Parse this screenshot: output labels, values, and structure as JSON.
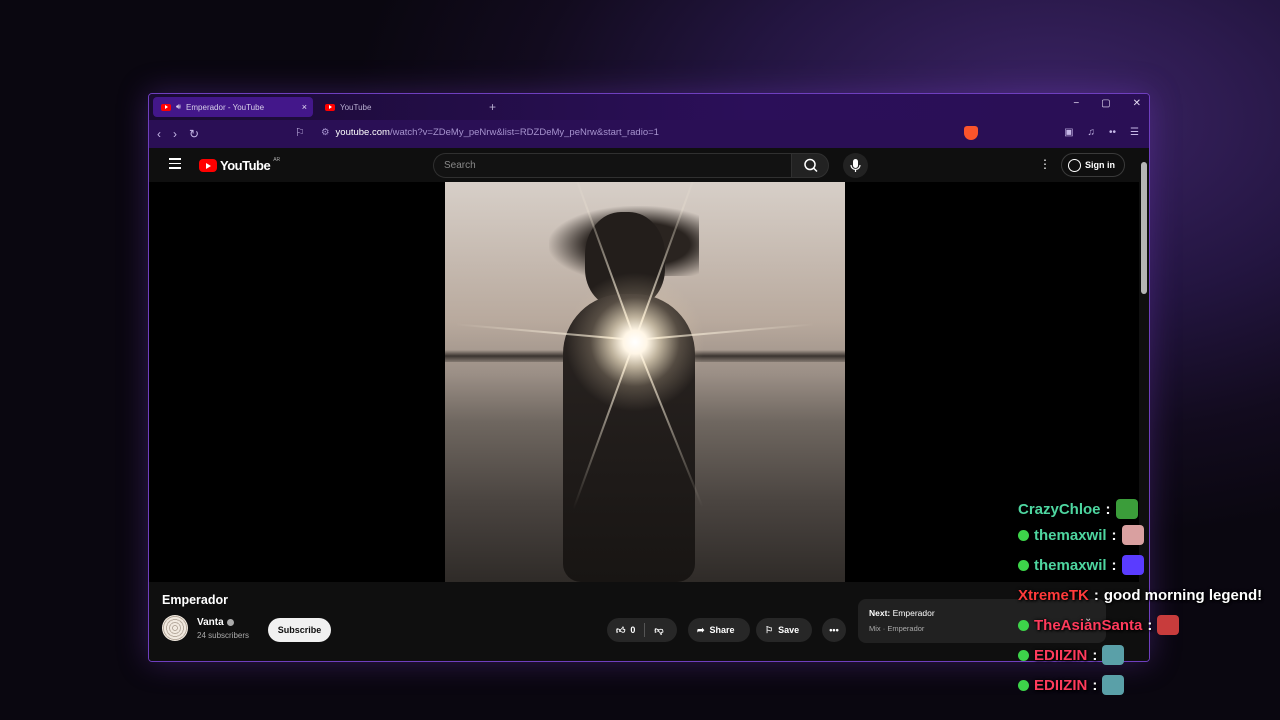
{
  "browser": {
    "tabs": [
      {
        "label": "Emperador - YouTube",
        "active": true
      },
      {
        "label": "YouTube",
        "active": false
      }
    ],
    "url_host": "youtube.com",
    "url_path": "/watch?v=ZDeMy_peNrw&list=RDZDeMy_peNrw&start_radio=1",
    "new_tab_symbol": "+",
    "close_symbol": "×",
    "window_controls": [
      "−",
      "▢",
      "✕"
    ]
  },
  "youtube": {
    "logo_text": "YouTube",
    "region": "AR",
    "search_placeholder": "Search",
    "signin_label": "Sign in"
  },
  "video": {
    "title": "Emperador",
    "channel": "Vanta",
    "subscribers": "24 subscribers",
    "subscribe_label": "Subscribe",
    "likes": "0",
    "share_label": "Share",
    "save_label": "Save",
    "next_prefix": "Next:",
    "next_title": "Emperador",
    "next_sub": "Mix · Emperador"
  },
  "chat": [
    {
      "user": "CrazyChloe",
      "color": "#4ed6a0",
      "badge": false,
      "text": "",
      "emote": "e1"
    },
    {
      "user": "themaxwil",
      "color": "#4ed6a0",
      "badge": true,
      "text": "",
      "emote": "e2"
    },
    {
      "user": "themaxwil",
      "color": "#4ed6a0",
      "badge": true,
      "text": "",
      "emote": "e3"
    },
    {
      "user": "XtremeTK",
      "color": "#ff3b3b",
      "badge": false,
      "text": "good morning legend!",
      "emote": ""
    },
    {
      "user": "TheAsianSanta",
      "color": "#ff3b5c",
      "badge": true,
      "text": "",
      "emote": "e4"
    },
    {
      "user": "EDIIZIN",
      "color": "#ff3b5c",
      "badge": true,
      "text": "",
      "emote": "e5"
    },
    {
      "user": "EDIIZIN",
      "color": "#ff3b5c",
      "badge": true,
      "text": "",
      "emote": "e5"
    }
  ]
}
